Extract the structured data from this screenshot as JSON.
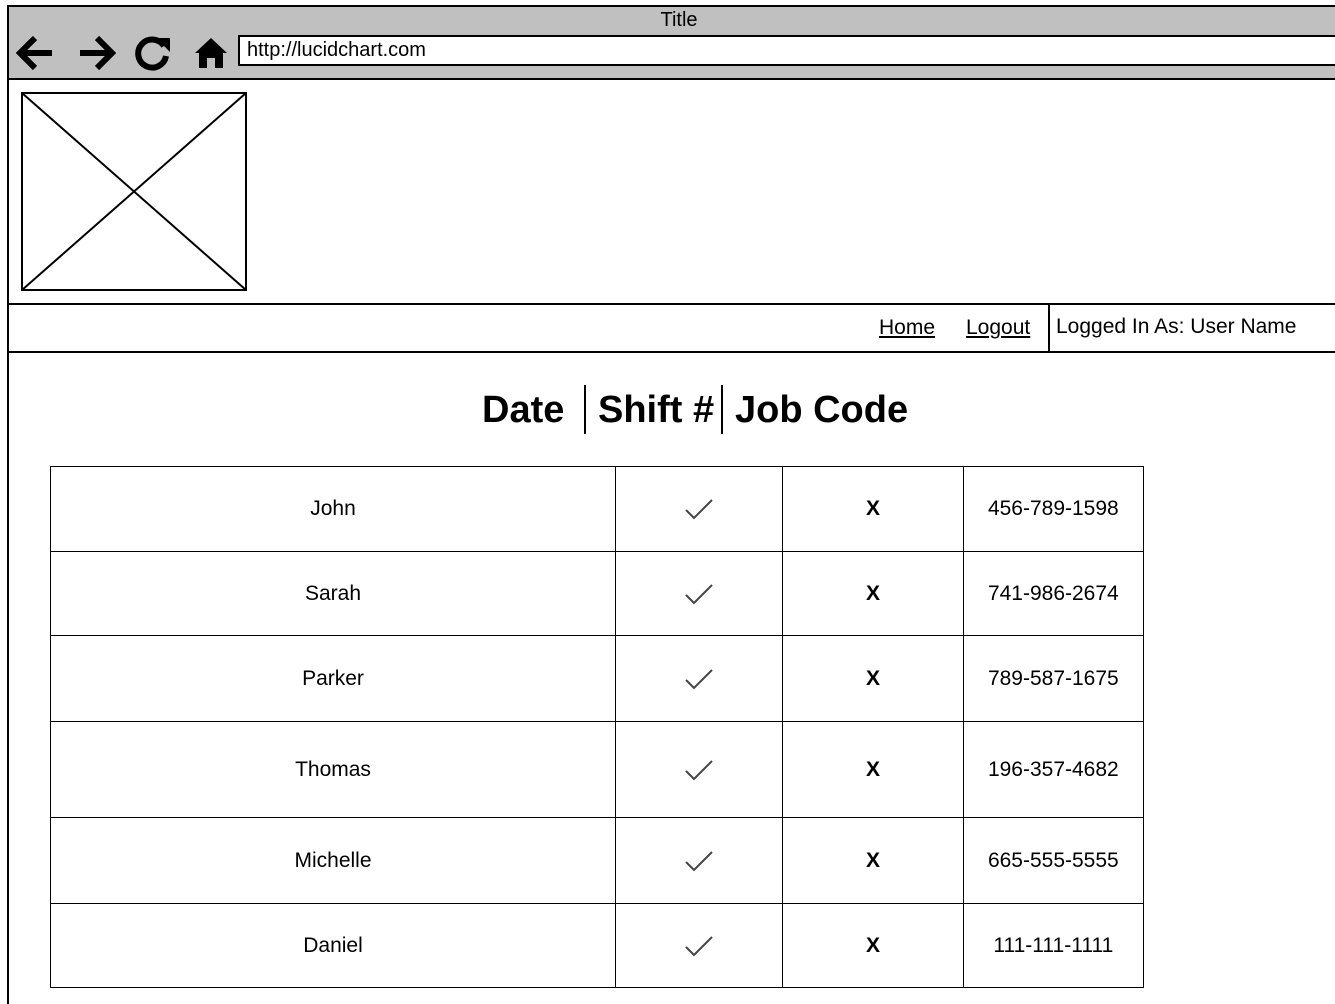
{
  "window": {
    "title": "Title",
    "url": "http://lucidchart.com"
  },
  "nav": {
    "home": "Home",
    "logout": "Logout",
    "logged_in": "Logged In As: User Name"
  },
  "headers": {
    "date": "Date",
    "shift": "Shift #",
    "job_code": "Job Code"
  },
  "rows": [
    {
      "name": "John",
      "checked": true,
      "mark": "X",
      "phone": "456-789-1598"
    },
    {
      "name": "Sarah",
      "checked": true,
      "mark": "X",
      "phone": "741-986-2674"
    },
    {
      "name": "Parker",
      "checked": true,
      "mark": "X",
      "phone": "789-587-1675"
    },
    {
      "name": "Thomas",
      "checked": true,
      "mark": "X",
      "phone": "196-357-4682"
    },
    {
      "name": "Michelle",
      "checked": true,
      "mark": "X",
      "phone": "665-555-5555"
    },
    {
      "name": "Daniel",
      "checked": true,
      "mark": "X",
      "phone": "111-111-1111"
    }
  ],
  "icons": {
    "back": "arrow-left-icon",
    "forward": "arrow-right-icon",
    "reload": "reload-icon",
    "home": "home-icon",
    "logo": "image-placeholder",
    "check": "check-icon"
  }
}
